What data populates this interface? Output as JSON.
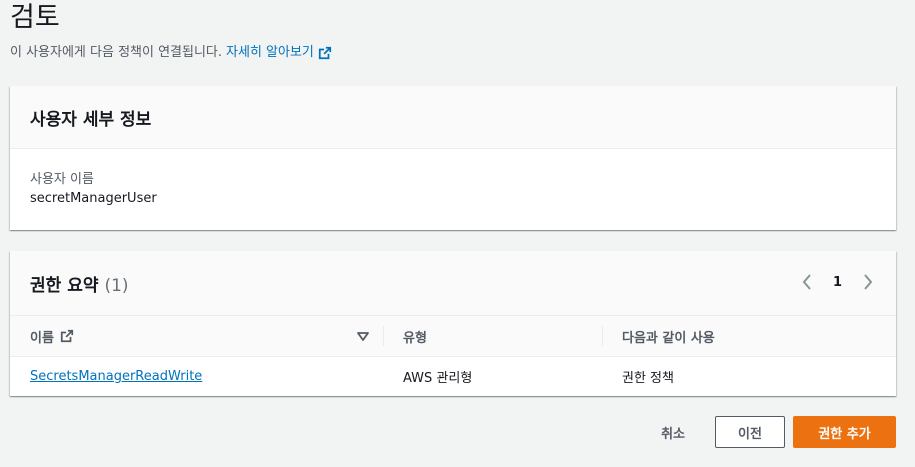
{
  "page": {
    "title": "검토",
    "description": "이 사용자에게 다음 정책이 연결됩니다.",
    "learn_more": "자세히 알아보기"
  },
  "user_details": {
    "title": "사용자 세부 정보",
    "username_label": "사용자 이름",
    "username_value": "secretManagerUser"
  },
  "permissions": {
    "title": "권한 요약",
    "count": "(1)",
    "page": "1",
    "columns": [
      "이름",
      "유형",
      "다음과 같이 사용"
    ],
    "rows": [
      {
        "name": "SecretsManagerReadWrite",
        "type": "AWS 관리형",
        "used_as": "권한 정책"
      }
    ]
  },
  "actions": {
    "cancel": "취소",
    "previous": "이전",
    "add_permissions": "권한 추가"
  },
  "colors": {
    "link": "#0073bb",
    "primary": "#ec7211"
  }
}
